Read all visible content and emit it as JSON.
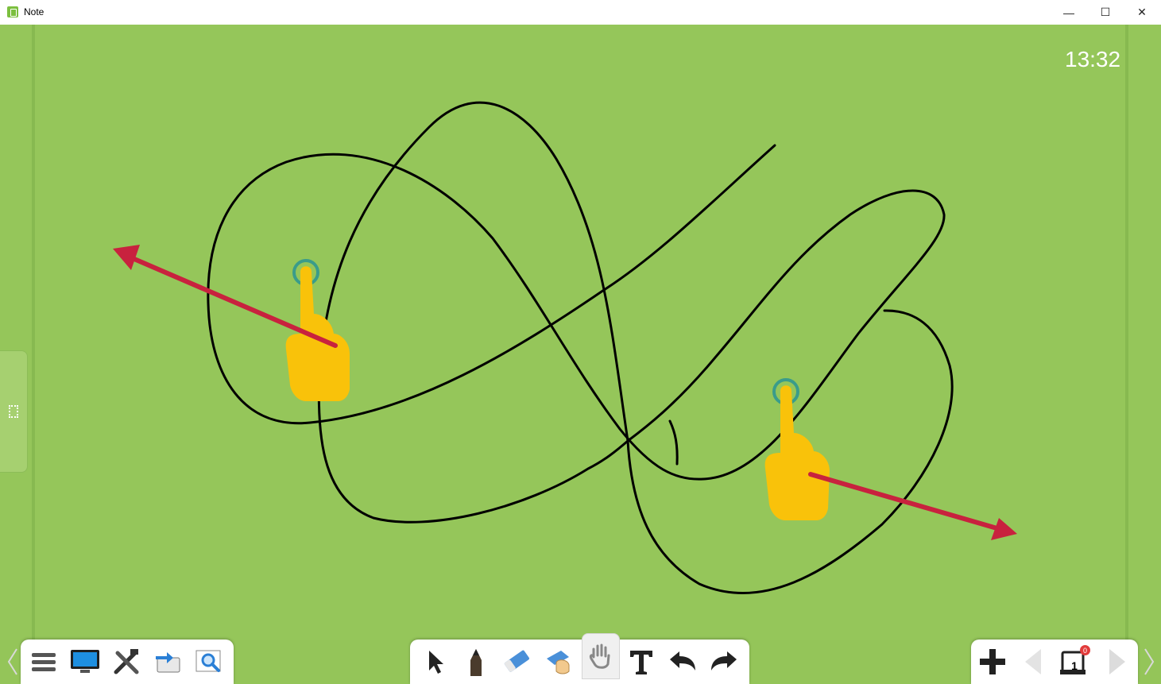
{
  "window": {
    "title": "Note",
    "minimize_glyph": "—",
    "maximize_glyph": "☐",
    "close_glyph": "✕"
  },
  "canvas": {
    "clock": "13:32",
    "background_color": "#95c65a"
  },
  "overlay": {
    "hand_color": "#f9c20a",
    "arrow_color": "#c8223e",
    "gesture": "two-finger-spread"
  },
  "toolbar": {
    "left_tools": [
      "menu-icon",
      "screen-icon",
      "tools-icon",
      "switch-icon",
      "magnifier-icon"
    ],
    "center_tools": [
      "select-icon",
      "pencil-icon",
      "eraser-icon",
      "eraser-hand-icon",
      "roam-hand-icon",
      "text-icon",
      "undo-icon",
      "redo-icon"
    ],
    "active_tool": "roam-hand-icon",
    "right_tools": [
      "add-page-icon",
      "prev-page-icon",
      "page-manager-icon",
      "next-page-icon"
    ],
    "page_number": "1",
    "page_badge": "0"
  }
}
